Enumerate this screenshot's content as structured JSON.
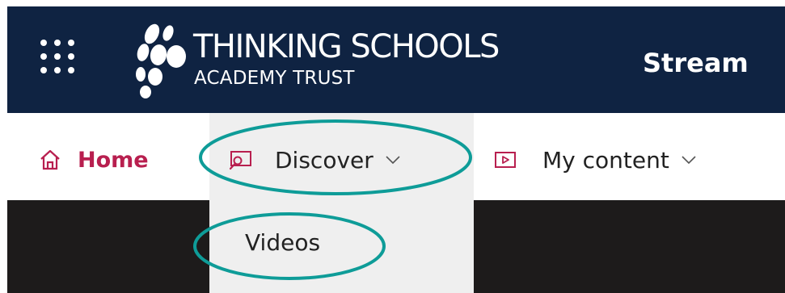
{
  "header": {
    "brand_line1": "THINKING SCHOOLS",
    "brand_line2": "ACADEMY TRUST",
    "app_name": "Stream",
    "background": "#0f2342"
  },
  "nav": {
    "home": {
      "label": "Home",
      "icon": "home-icon",
      "color": "#b81f4f"
    },
    "discover": {
      "label": "Discover",
      "icon": "discover-icon",
      "expanded": true
    },
    "my_content": {
      "label": "My content",
      "icon": "video-play-icon"
    }
  },
  "dropdown": {
    "items": [
      {
        "label": "Videos"
      }
    ]
  },
  "annotation": {
    "highlight_color": "#0e9c98"
  }
}
